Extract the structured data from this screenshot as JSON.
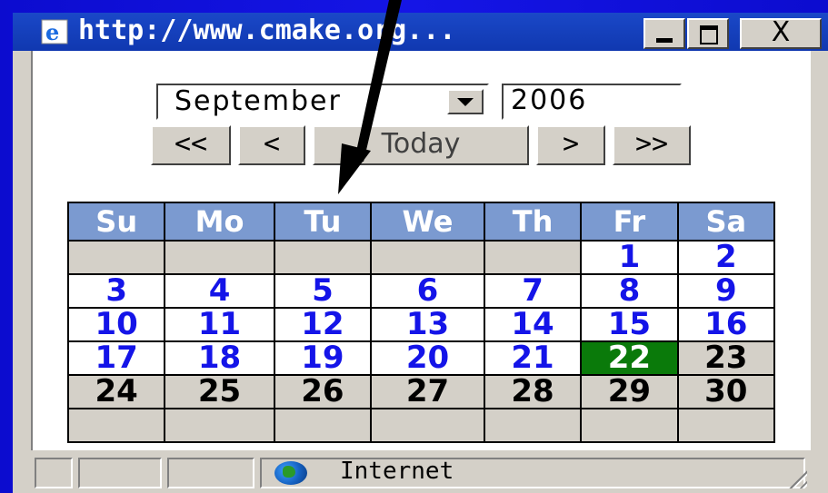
{
  "window": {
    "title": "http://www.cmake.org...",
    "minimize_label": "_",
    "maximize_label": "□",
    "close_label": "X"
  },
  "date_controls": {
    "month": "September",
    "year": "2006"
  },
  "nav": {
    "prev_year": "<<",
    "prev_month": "<",
    "today": "Today",
    "next_month": ">",
    "next_year": ">>"
  },
  "calendar": {
    "weekdays": [
      "Su",
      "Mo",
      "Tu",
      "We",
      "Th",
      "Fr",
      "Sa"
    ],
    "weeks": [
      [
        "",
        "",
        "",
        "",
        "",
        "1",
        "2"
      ],
      [
        "3",
        "4",
        "5",
        "6",
        "7",
        "8",
        "9"
      ],
      [
        "10",
        "11",
        "12",
        "13",
        "14",
        "15",
        "16"
      ],
      [
        "17",
        "18",
        "19",
        "20",
        "21",
        "22",
        "23"
      ],
      [
        "24",
        "25",
        "26",
        "27",
        "28",
        "29",
        "30"
      ],
      [
        "",
        "",
        "",
        "",
        "",
        "",
        ""
      ]
    ],
    "selected_day": "22",
    "colors": {
      "header_bg": "#7b9ad0",
      "current_day_text": "#1414e8",
      "selected_bg": "#0a7a0a",
      "other_bg": "#d4d0c8"
    }
  },
  "statusbar": {
    "zone": "Internet",
    "zone_icon": "globe-icon"
  }
}
